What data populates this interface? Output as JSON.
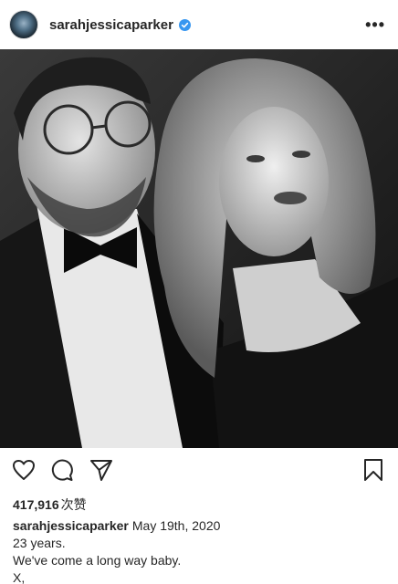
{
  "header": {
    "username": "sarahjessicaparker",
    "more_label": "•••",
    "avatar": "profile-eye-avatar",
    "verified_icon": "verified-badge-icon"
  },
  "post": {
    "photo_description_alt": "black-and-white photo"
  },
  "actions": {
    "like_icon": "heart-icon",
    "comment_icon": "comment-icon",
    "share_icon": "send-icon",
    "save_icon": "bookmark-icon"
  },
  "likes": {
    "count": "417,916",
    "label": "次赞"
  },
  "caption": {
    "username": "sarahjessicaparker",
    "date": "May 19th, 2020",
    "lines": [
      "23 years.",
      "We've come a long way baby.",
      "X,"
    ]
  },
  "colors": {
    "text": "#262626",
    "verified": "#3897f0",
    "background": "#ffffff"
  }
}
